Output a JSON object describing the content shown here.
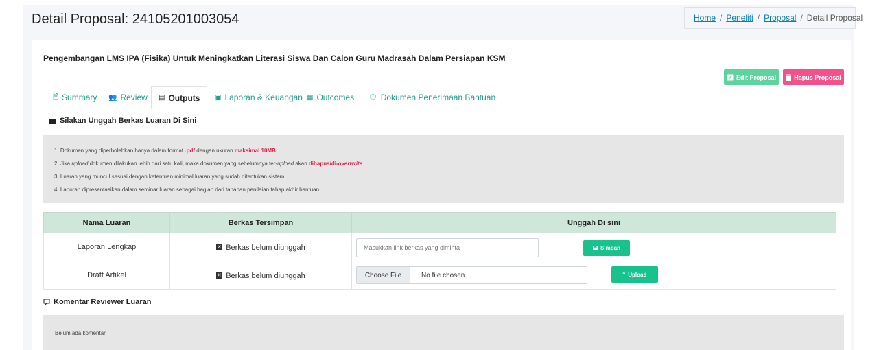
{
  "header": {
    "title": "Detail Proposal: 24105201003054",
    "breadcrumb": {
      "home": "Home",
      "peneliti": "Peneliti",
      "proposal": "Proposal",
      "current": "Detail Proposal"
    }
  },
  "proposal": {
    "title": "Pengembangan LMS IPA (Fisika) Untuk Meningkatkan Literasi Siswa Dan Calon Guru Madrasah Dalam Persiapan KSM",
    "edit_label": "Edit Proposal",
    "delete_label": "Hapus Proposal"
  },
  "tabs": [
    {
      "label": "Summary",
      "icon": "summary-icon"
    },
    {
      "label": "Review",
      "icon": "users-icon"
    },
    {
      "label": "Outputs",
      "icon": "outputs-icon"
    },
    {
      "label": "Laporan & Keuangan",
      "icon": "money-icon"
    },
    {
      "label": "Outcomes",
      "icon": "outcomes-icon"
    },
    {
      "label": "Dokumen Penerimaan Bantuan",
      "icon": "document-icon"
    }
  ],
  "section": {
    "title": "Silakan Unggah Berkas Luaran Di Sini"
  },
  "notes": {
    "n1a": "1. Dokumen yang diperbolehkan hanya dalam format ",
    "n1b": ".pdf",
    "n1c": " dengan ukuran ",
    "n1d": "maksimal 10MB",
    "n1e": ".",
    "n2a": "2. Jika ",
    "n2b": "upload",
    "n2c": " dokumen dilakukan lebih dari satu kali, maka dokumen yang sebelumnya ter-",
    "n2d": "upload",
    "n2e": " akan ",
    "n2f": "dihapus/di-",
    "n2g": "overwrite",
    "n2h": ".",
    "n3": "3. Luaran yang muncul sesuai dengan ketentuan minimal luaran yang sudah ditentukan sistem.",
    "n4": "4. Laporan dipresentasikan dalam seminar luaran sebagai bagian dari tahapan penilaian tahap akhir bantuan."
  },
  "table": {
    "headers": [
      "Nama Luaran",
      "Berkas Tersimpan",
      "Unggah Di sini"
    ],
    "rows": [
      {
        "name": "Laporan Lengkap",
        "stored": "Berkas belum diunggah",
        "placeholder": "Masukkan link berkas yang diminta",
        "button": "Simpan"
      },
      {
        "name": "Draft Artikel",
        "stored": "Berkas belum diunggah",
        "choose": "Choose File",
        "file": "No file chosen",
        "button": "Upload"
      }
    ]
  },
  "review": {
    "title": "Komentar Reviewer Luaran",
    "empty": "Belum ada komentar."
  },
  "colors": {
    "accent": "#20a08a",
    "edit_button": "#5dd39e",
    "delete_button": "#f4518a",
    "action_button": "#19c28c",
    "table_header": "#cfe6da",
    "warning_text": "#e0204a"
  }
}
